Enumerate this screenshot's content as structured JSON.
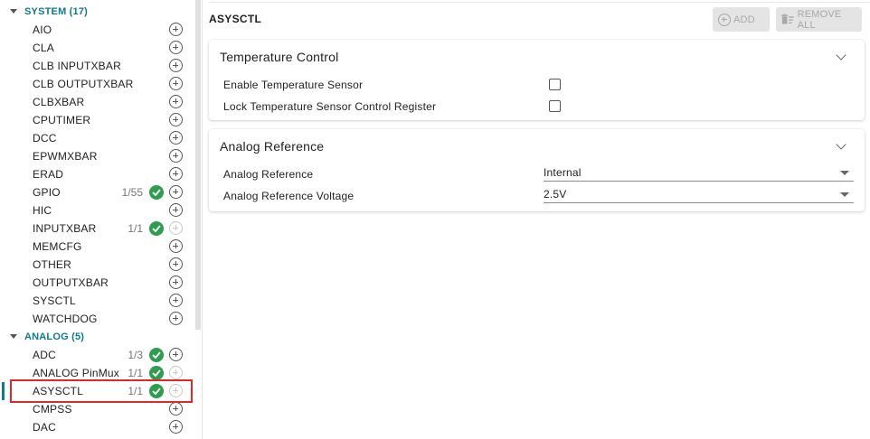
{
  "sidebar": {
    "categories": [
      {
        "label": "SYSTEM (17)"
      },
      {
        "label": "ANALOG (5)"
      }
    ],
    "system_items": [
      {
        "label": "AIO"
      },
      {
        "label": "CLA"
      },
      {
        "label": "CLB INPUTXBAR"
      },
      {
        "label": "CLB OUTPUTXBAR"
      },
      {
        "label": "CLBXBAR"
      },
      {
        "label": "CPUTIMER"
      },
      {
        "label": "DCC"
      },
      {
        "label": "EPWMXBAR"
      },
      {
        "label": "ERAD"
      },
      {
        "label": "GPIO",
        "count": "1/55"
      },
      {
        "label": "HIC"
      },
      {
        "label": "INPUTXBAR",
        "count": "1/1"
      },
      {
        "label": "MEMCFG"
      },
      {
        "label": "OTHER"
      },
      {
        "label": "OUTPUTXBAR"
      },
      {
        "label": "SYSCTL"
      },
      {
        "label": "WATCHDOG"
      }
    ],
    "analog_items": [
      {
        "label": "ADC",
        "count": "1/3"
      },
      {
        "label": "ANALOG PinMux",
        "count": "1/1"
      },
      {
        "label": "ASYSCTL",
        "count": "1/1"
      },
      {
        "label": "CMPSS"
      },
      {
        "label": "DAC"
      }
    ]
  },
  "main": {
    "title": "ASYSCTL",
    "add_label": "ADD",
    "remove_all_label": "REMOVE ALL",
    "temperature_card": {
      "title": "Temperature Control",
      "rows": [
        {
          "label": "Enable Temperature Sensor"
        },
        {
          "label": "Lock Temperature Sensor Control Register"
        }
      ]
    },
    "analog_reference_card": {
      "title": "Analog Reference",
      "rows": [
        {
          "label": "Analog Reference",
          "value": "Internal"
        },
        {
          "label": "Analog Reference Voltage",
          "value": "2.5V"
        }
      ]
    }
  },
  "colors": {
    "accent": "#0f7b8a",
    "check_green": "#2e9d4f",
    "highlight_red": "#e0282a"
  }
}
